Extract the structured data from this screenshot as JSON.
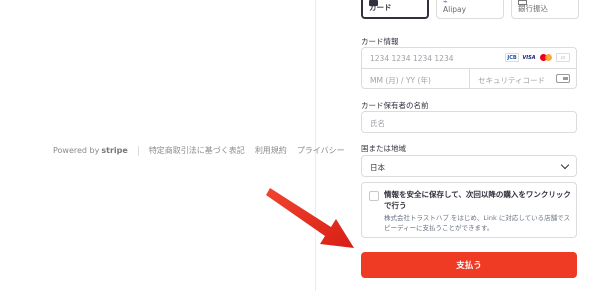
{
  "footer": {
    "powered_by": "Powered by",
    "brand": "stripe",
    "links": [
      "特定商取引法に基づく表記",
      "利用規約",
      "プライバシー"
    ]
  },
  "payment_tabs": [
    {
      "label": "カード",
      "icon": "card-icon",
      "selected": true
    },
    {
      "label": "Alipay",
      "icon": "alipay-icon",
      "selected": false
    },
    {
      "label": "銀行振込",
      "icon": "bank-icon",
      "selected": false
    }
  ],
  "card_info": {
    "label": "カード情報",
    "number_placeholder": "1234 1234 1234 1234",
    "expiry_placeholder": "MM (月) / YY (年)",
    "cvc_placeholder": "セキュリティコード",
    "brands": [
      "JCB",
      "VISA",
      "mastercard-icon",
      "amex-icon"
    ]
  },
  "cardholder": {
    "label": "カード保有者の名前",
    "placeholder": "氏名"
  },
  "country": {
    "label": "国または地域",
    "value": "日本"
  },
  "save_info": {
    "title": "情報を安全に保存して、次回以降の購入をワンクリックで行う",
    "description": "株式会社トラストハブ をはじめ、Link に対応している店舗でスピーディーに支払うことができます。"
  },
  "pay_button": {
    "label": "支払う",
    "color": "#ef3a24"
  },
  "annotation_arrow": {
    "color": "#e8261c",
    "points_to": "pay-button"
  }
}
